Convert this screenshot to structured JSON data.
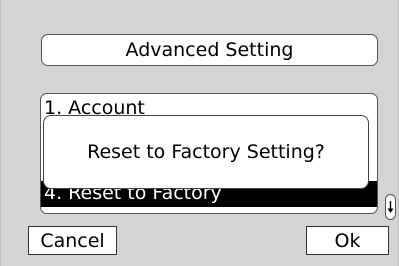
{
  "header": {
    "title": "Advanced Setting"
  },
  "menu": {
    "items": [
      {
        "label": "1. Account"
      },
      {
        "label": "4. Reset to Factory",
        "selected": true
      }
    ]
  },
  "dialog": {
    "message": "Reset to Factory Setting?"
  },
  "scroll": {
    "icon": "down-arrow-icon"
  },
  "softkeys": {
    "left_label": "Cancel",
    "right_label": "Ok"
  },
  "colors": {
    "background": "#d4d4d4",
    "selection": "#000000",
    "selection_text": "#ffffff"
  }
}
